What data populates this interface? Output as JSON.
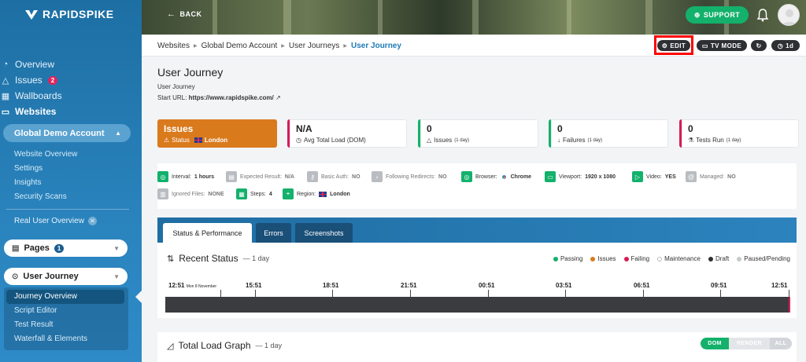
{
  "brand": {
    "name": "RAPIDSPIKE"
  },
  "header": {
    "back_label": "BACK",
    "support_label": "SUPPORT"
  },
  "sidebar": {
    "nav": [
      {
        "label": "Overview",
        "icon": "dashboard-icon"
      },
      {
        "label": "Issues",
        "icon": "warning-icon",
        "badge": "2"
      },
      {
        "label": "Wallboards",
        "icon": "wallboard-icon"
      },
      {
        "label": "Websites",
        "icon": "monitor-icon"
      }
    ],
    "account": "Global Demo Account",
    "account_links": [
      "Website Overview",
      "Settings",
      "Insights",
      "Security Scans"
    ],
    "rum_label": "Real User Overview",
    "pages_select": {
      "label": "Pages",
      "badge": "1"
    },
    "journey_select": {
      "label": "User Journey"
    },
    "journey_links": [
      "Journey Overview",
      "Script Editor",
      "Test Result",
      "Waterfall & Elements"
    ]
  },
  "breadcrumb": {
    "items": [
      "Websites",
      "Global Demo Account",
      "User Journeys"
    ],
    "current": "User Journey"
  },
  "toolbar": {
    "edit": "EDIT",
    "tv_mode": "TV MODE",
    "range": "1d"
  },
  "page": {
    "title": "User Journey",
    "subtitle": "User Journey",
    "start_url_label": "Start URL:",
    "start_url": "https://www.rapidspike.com/"
  },
  "metrics": [
    {
      "value": "Issues",
      "label": "Status",
      "flag": "London"
    },
    {
      "value": "N/A",
      "label": "Avg Total Load (DOM)"
    },
    {
      "value": "0",
      "label": "Issues",
      "small": "(1 day)"
    },
    {
      "value": "0",
      "label": "Failures",
      "small": "(1 day)"
    },
    {
      "value": "0",
      "label": "Tests Run",
      "small": "(1 day)"
    }
  ],
  "chips": {
    "interval": {
      "label": "Interval:",
      "value": "1 hours"
    },
    "expected": {
      "label": "Expected Result:",
      "value": "N/A"
    },
    "basic_auth": {
      "label": "Basic Auth:",
      "value": "NO"
    },
    "redirects": {
      "label": "Following Redirects:",
      "value": "NO"
    },
    "browser": {
      "label": "Browser:",
      "value": "Chrome"
    },
    "viewport": {
      "label": "Viewport:",
      "value": "1920 x 1080"
    },
    "video": {
      "label": "Video:",
      "value": "YES"
    },
    "managed": {
      "label": "Managed:",
      "value": "NO"
    },
    "ignored": {
      "label": "Ignored Files:",
      "value": "NONE"
    },
    "steps": {
      "label": "Steps:",
      "value": "4"
    },
    "region": {
      "label": "Region:",
      "value": "London"
    }
  },
  "tabs": [
    "Status & Performance",
    "Errors",
    "Screenshots"
  ],
  "recent_status": {
    "title": "Recent Status",
    "range": "— 1 day",
    "legend": [
      {
        "label": "Passing",
        "color": "#13b16b"
      },
      {
        "label": "Issues",
        "color": "#d97a1d"
      },
      {
        "label": "Failing",
        "color": "#d81b55"
      },
      {
        "label": "Maintenance",
        "color": "#ffffff"
      },
      {
        "label": "Draft",
        "color": "#2d2f33"
      },
      {
        "label": "Paused/Pending",
        "color": "#c5c8cc"
      }
    ],
    "ticks": [
      "12:51",
      "15:51",
      "18:51",
      "21:51",
      "00:51",
      "03:51",
      "06:51",
      "09:51",
      "12:51"
    ],
    "first_tick_date": "Mon 8 November"
  },
  "load_graph": {
    "title": "Total Load Graph",
    "range": "— 1 day",
    "toggles": [
      "DOM",
      "RENDER",
      "ALL"
    ],
    "selected": "DOM"
  },
  "colors": {
    "accent": "#13b16b",
    "brand_blue": "#1f7ab8",
    "issue_orange": "#d97a1d"
  }
}
